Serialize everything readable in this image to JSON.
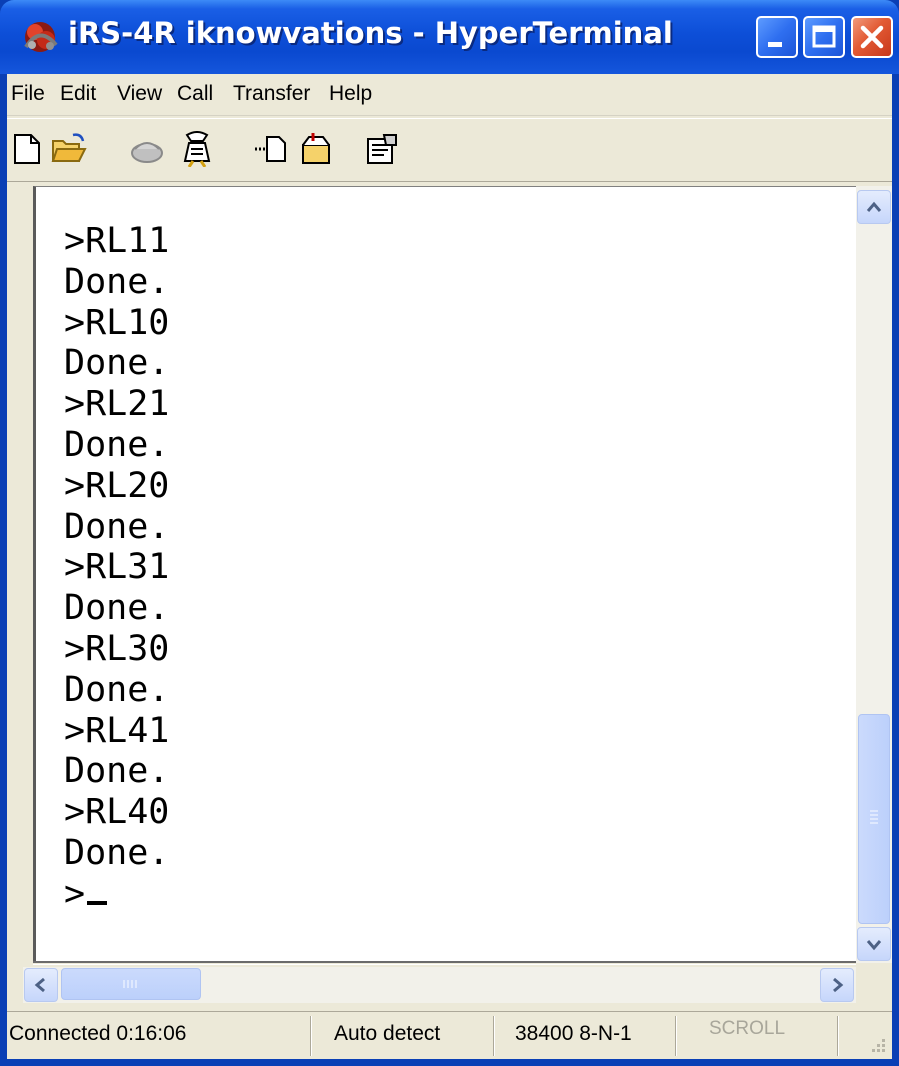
{
  "window": {
    "title": "iRS-4R iknowvations - HyperTerminal",
    "icon": "hyperterminal-icon",
    "controls": [
      "minimize",
      "maximize",
      "close"
    ]
  },
  "menu": {
    "items": [
      "File",
      "Edit",
      "View",
      "Call",
      "Transfer",
      "Help"
    ]
  },
  "toolbar": {
    "icons": [
      "new-icon",
      "open-icon",
      "call-icon",
      "disconnect-icon",
      "send-icon",
      "receive-icon",
      "properties-icon"
    ]
  },
  "terminal": {
    "lines": [
      ">RL11",
      "Done.",
      ">RL10",
      "Done.",
      ">RL21",
      "Done.",
      ">RL20",
      "Done.",
      ">RL31",
      "Done.",
      ">RL30",
      "Done.",
      ">RL41",
      "Done.",
      ">RL40",
      "Done."
    ],
    "prompt": ">"
  },
  "scrollbars": {
    "vertical_position": 0.95,
    "horizontal_position": 0.0
  },
  "status": {
    "connected": "Connected 0:16:06",
    "detect": "Auto detect",
    "port_settings": "38400 8-N-1",
    "scroll": "SCROLL"
  },
  "colors": {
    "titlebar": "#0a49d0",
    "close_button": "#e25a34",
    "chrome": "#ece9d8",
    "terminal_bg": "#ffffff"
  }
}
